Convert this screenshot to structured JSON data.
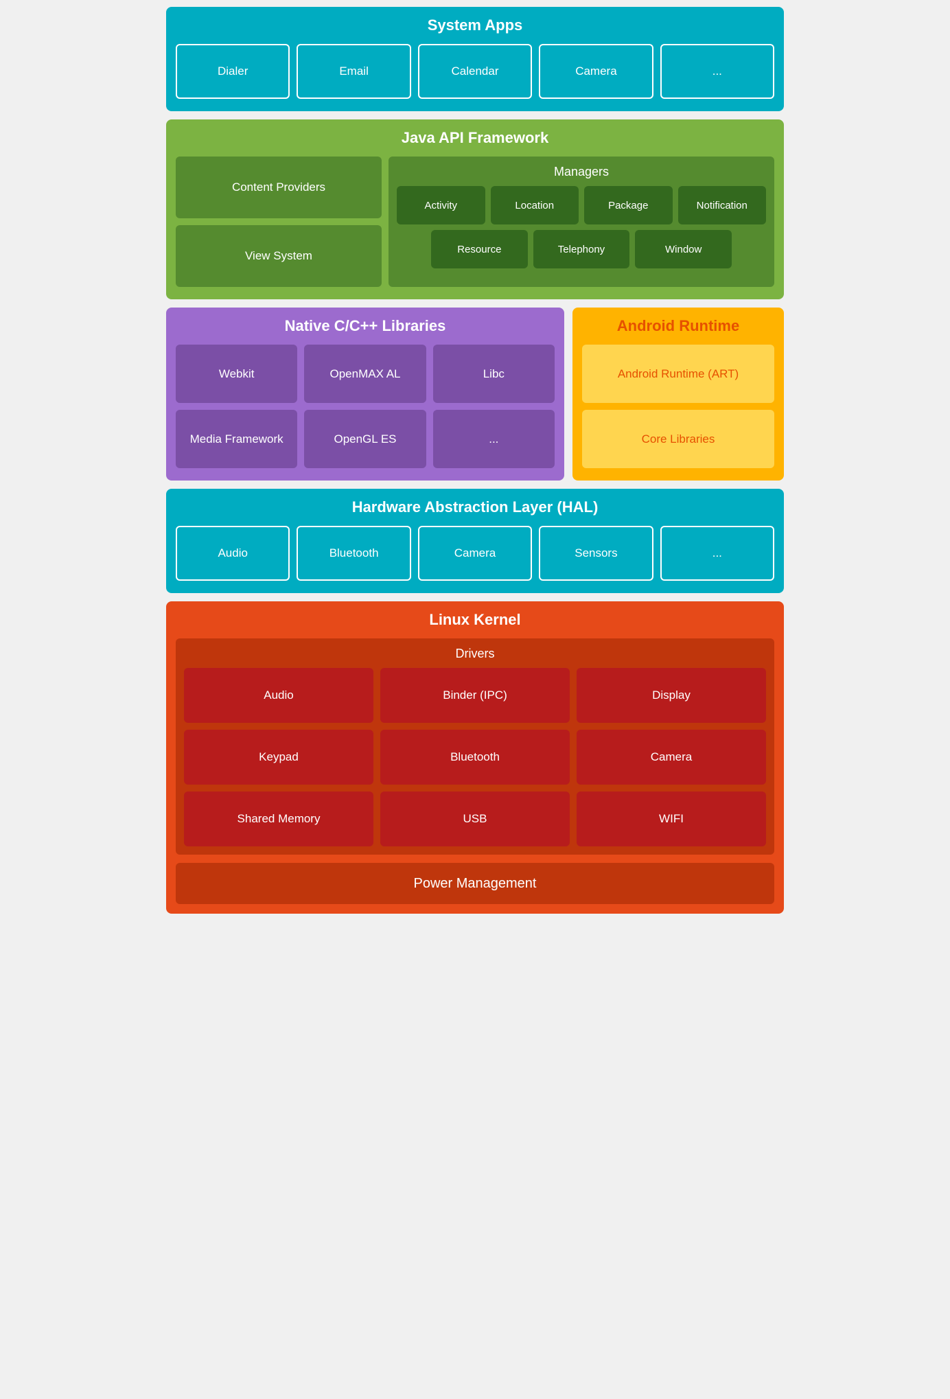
{
  "systemApps": {
    "title": "System Apps",
    "apps": [
      "Dialer",
      "Email",
      "Calendar",
      "Camera",
      "..."
    ]
  },
  "javaAPI": {
    "title": "Java API Framework",
    "leftItems": [
      "Content Providers",
      "View System"
    ],
    "managers": {
      "title": "Managers",
      "row1": [
        "Activity",
        "Location",
        "Package",
        "Notification"
      ],
      "row2": [
        "Resource",
        "Telephony",
        "Window"
      ]
    }
  },
  "nativeCpp": {
    "title": "Native C/C++ Libraries",
    "items": [
      "Webkit",
      "OpenMAX AL",
      "Libc",
      "Media Framework",
      "OpenGL ES",
      "..."
    ]
  },
  "androidRuntime": {
    "title": "Android Runtime",
    "items": [
      "Android Runtime (ART)",
      "Core Libraries"
    ]
  },
  "hal": {
    "title": "Hardware Abstraction Layer (HAL)",
    "items": [
      "Audio",
      "Bluetooth",
      "Camera",
      "Sensors",
      "..."
    ]
  },
  "linuxKernel": {
    "title": "Linux Kernel",
    "drivers": {
      "title": "Drivers",
      "items": [
        "Audio",
        "Binder (IPC)",
        "Display",
        "Keypad",
        "Bluetooth",
        "Camera",
        "Shared Memory",
        "USB",
        "WIFI"
      ]
    },
    "powerManagement": "Power Management"
  }
}
